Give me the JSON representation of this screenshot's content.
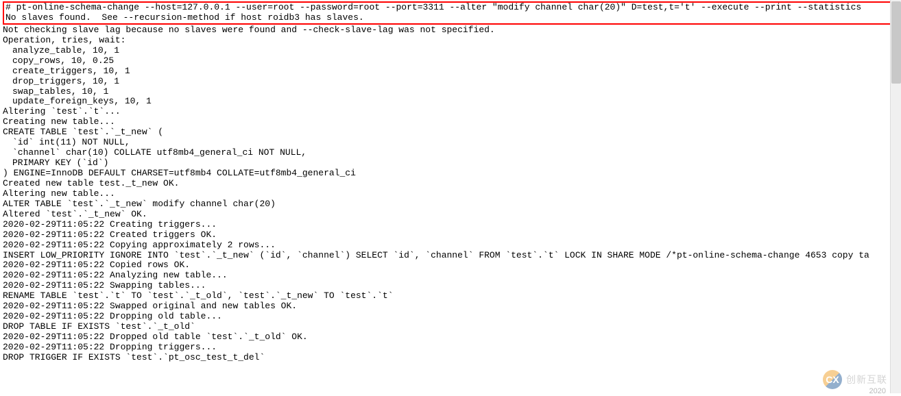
{
  "highlighted": {
    "command": "# pt-online-schema-change --host=127.0.0.1 --user=root --password=root --port=3311 --alter \"modify channel char(20)\" D=test,t='t' --execute --print --statistics",
    "warning": "No slaves found.  See --recursion-method if host roidb3 has slaves."
  },
  "output": {
    "l01": "Not checking slave lag because no slaves were found and --check-slave-lag was not specified.",
    "l02": "Operation, tries, wait:",
    "l03": "analyze_table, 10, 1",
    "l04": "copy_rows, 10, 0.25",
    "l05": "create_triggers, 10, 1",
    "l06": "drop_triggers, 10, 1",
    "l07": "swap_tables, 10, 1",
    "l08": "update_foreign_keys, 10, 1",
    "l09": "Altering `test`.`t`...",
    "l10": "Creating new table...",
    "l11": "CREATE TABLE `test`.`_t_new` (",
    "l12": "`id` int(11) NOT NULL,",
    "l13": "`channel` char(10) COLLATE utf8mb4_general_ci NOT NULL,",
    "l14": "PRIMARY KEY (`id`)",
    "l15": ") ENGINE=InnoDB DEFAULT CHARSET=utf8mb4 COLLATE=utf8mb4_general_ci",
    "l16": "Created new table test._t_new OK.",
    "l17": "Altering new table...",
    "l18": "ALTER TABLE `test`.`_t_new` modify channel char(20)",
    "l19": "Altered `test`.`_t_new` OK.",
    "l20": "2020-02-29T11:05:22 Creating triggers...",
    "l21": "2020-02-29T11:05:22 Created triggers OK.",
    "l22": "2020-02-29T11:05:22 Copying approximately 2 rows...",
    "l23": "INSERT LOW_PRIORITY IGNORE INTO `test`.`_t_new` (`id`, `channel`) SELECT `id`, `channel` FROM `test`.`t` LOCK IN SHARE MODE /*pt-online-schema-change 4653 copy ta",
    "l24": "2020-02-29T11:05:22 Copied rows OK.",
    "l25": "2020-02-29T11:05:22 Analyzing new table...",
    "l26": "2020-02-29T11:05:22 Swapping tables...",
    "l27": "RENAME TABLE `test`.`t` TO `test`.`_t_old`, `test`.`_t_new` TO `test`.`t`",
    "l28": "2020-02-29T11:05:22 Swapped original and new tables OK.",
    "l29": "2020-02-29T11:05:22 Dropping old table...",
    "l30": "DROP TABLE IF EXISTS `test`.`_t_old`",
    "l31": "2020-02-29T11:05:22 Dropped old table `test`.`_t_old` OK.",
    "l32": "2020-02-29T11:05:22 Dropping triggers...",
    "l33": "DROP TRIGGER IF EXISTS `test`.`pt_osc_test_t_del`"
  },
  "watermark": {
    "icon_text": "CX",
    "label": "创新互联"
  },
  "footer_date": "2020"
}
